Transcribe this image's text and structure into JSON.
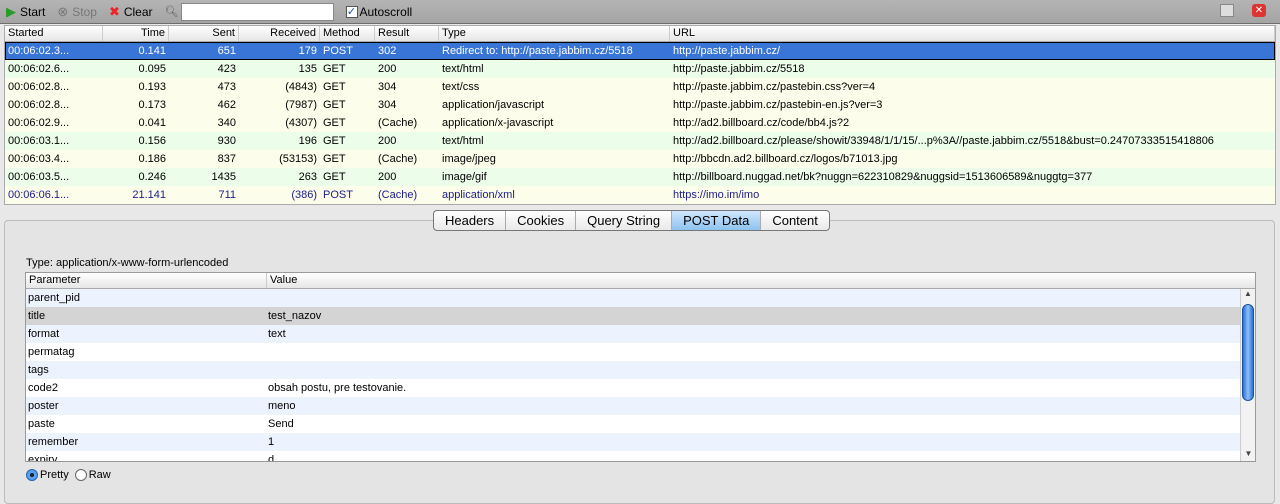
{
  "toolbar": {
    "start": "Start",
    "stop": "Stop",
    "clear": "Clear",
    "search_value": "",
    "autoscroll": "Autoscroll",
    "autoscroll_checked": true
  },
  "grid": {
    "columns": [
      "Started",
      "Time",
      "Sent",
      "Received",
      "Method",
      "Result",
      "Type",
      "URL"
    ],
    "rows": [
      [
        "00:06:02.3...",
        "0.141",
        "651",
        "179",
        "POST",
        "302",
        "Redirect to: http://paste.jabbim.cz/5518",
        "http://paste.jabbim.cz/"
      ],
      [
        "00:06:02.6...",
        "0.095",
        "423",
        "135",
        "GET",
        "200",
        "text/html",
        "http://paste.jabbim.cz/5518"
      ],
      [
        "00:06:02.8...",
        "0.193",
        "473",
        "(4843)",
        "GET",
        "304",
        "text/css",
        "http://paste.jabbim.cz/pastebin.css?ver=4"
      ],
      [
        "00:06:02.8...",
        "0.173",
        "462",
        "(7987)",
        "GET",
        "304",
        "application/javascript",
        "http://paste.jabbim.cz/pastebin-en.js?ver=3"
      ],
      [
        "00:06:02.9...",
        "0.041",
        "340",
        "(4307)",
        "GET",
        "(Cache)",
        "application/x-javascript",
        "http://ad2.billboard.cz/code/bb4.js?2"
      ],
      [
        "00:06:03.1...",
        "0.156",
        "930",
        "196",
        "GET",
        "200",
        "text/html",
        "http://ad2.billboard.cz/please/showit/33948/1/1/15/...p%3A//paste.jabbim.cz/5518&bust=0.24707333515418806"
      ],
      [
        "00:06:03.4...",
        "0.186",
        "837",
        "(53153)",
        "GET",
        "(Cache)",
        "image/jpeg",
        "http://bbcdn.ad2.billboard.cz/logos/b71013.jpg"
      ],
      [
        "00:06:03.5...",
        "0.246",
        "1435",
        "263",
        "GET",
        "200",
        "image/gif",
        "http://billboard.nuggad.net/bk?nuggn=622310829&nuggsid=1513606589&nuggtg=377"
      ],
      [
        "00:06:06.1...",
        "21.141",
        "711",
        "(386)",
        "POST",
        "(Cache)",
        "application/xml",
        "https://imo.im/imo"
      ]
    ]
  },
  "tabs": [
    "Headers",
    "Cookies",
    "Query String",
    "POST Data",
    "Content"
  ],
  "active_tab": "POST Data",
  "post": {
    "type_label": "Type: application/x-www-form-urlencoded",
    "columns": [
      "Parameter",
      "Value"
    ],
    "rows": [
      [
        "parent_pid",
        ""
      ],
      [
        "title",
        "test_nazov"
      ],
      [
        "format",
        "text"
      ],
      [
        "permatag",
        ""
      ],
      [
        "tags",
        ""
      ],
      [
        "code2",
        "obsah postu, pre testovanie."
      ],
      [
        "poster",
        "meno"
      ],
      [
        "paste",
        "Send"
      ],
      [
        "remember",
        "1"
      ],
      [
        "expiry",
        "d"
      ]
    ],
    "selected_row": "title"
  },
  "view_mode": {
    "pretty": "Pretty",
    "raw": "Raw",
    "selected": "Pretty"
  },
  "colors": {
    "selection": "#3875d7",
    "row_ok": "#ecfdea",
    "row_other": "#fdfdeb",
    "active_tab": "#8ec3f1"
  }
}
